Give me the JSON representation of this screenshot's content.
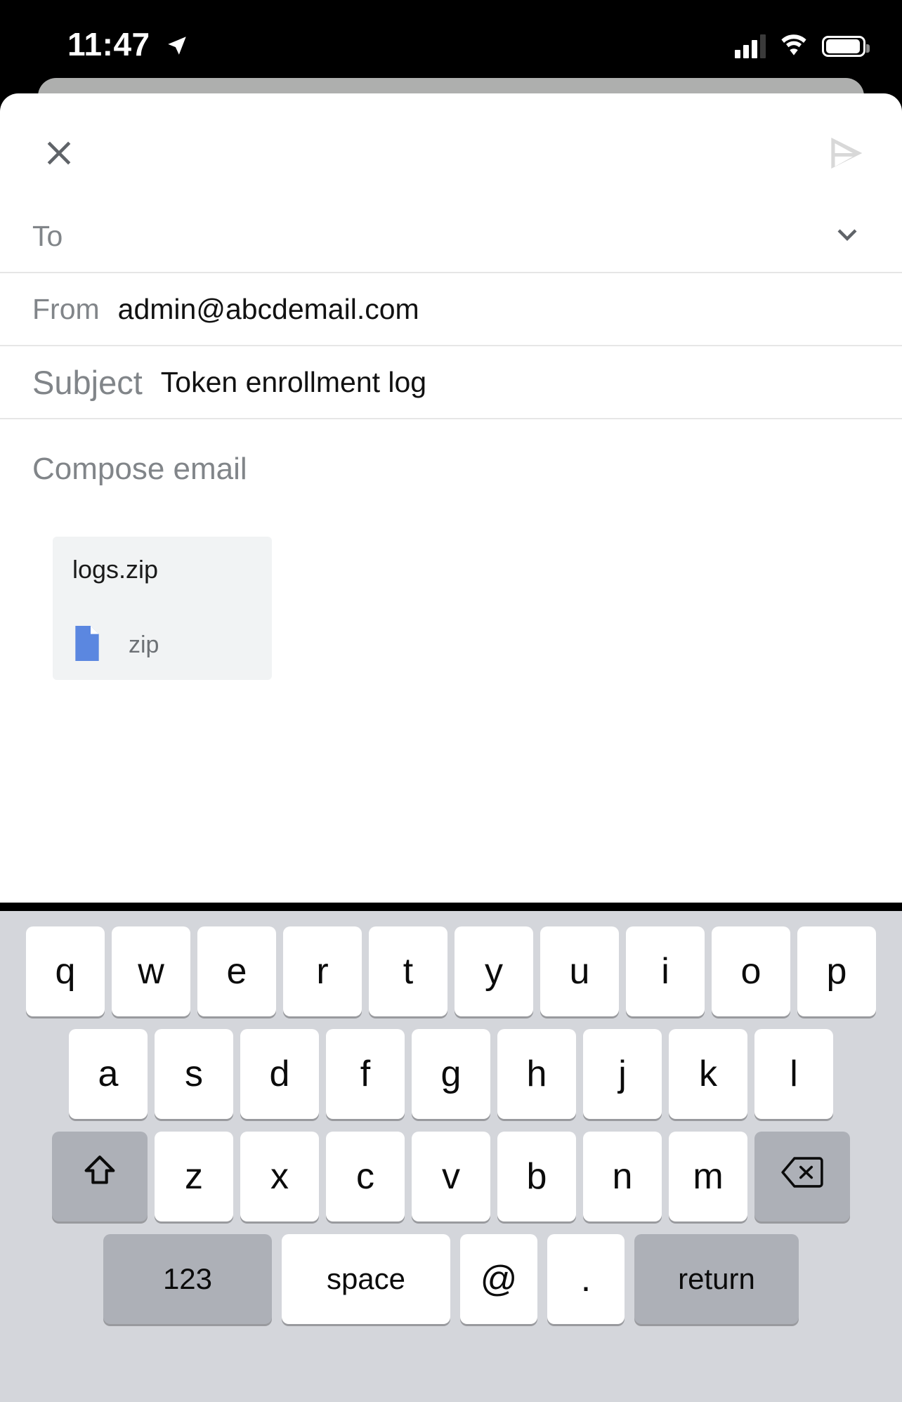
{
  "status_bar": {
    "time": "11:47",
    "location_icon": "location-arrow-icon",
    "signal_icon": "cellular-signal-icon",
    "wifi_icon": "wifi-icon",
    "battery_icon": "battery-icon"
  },
  "compose": {
    "close_icon": "close-icon",
    "send_icon": "send-icon",
    "to": {
      "placeholder": "To",
      "value": "",
      "expand_icon": "chevron-down-icon"
    },
    "from": {
      "label": "From",
      "value": "admin@abcdemail.com"
    },
    "subject": {
      "label": "Subject",
      "value": "Token enrollment log"
    },
    "body": {
      "placeholder": "Compose email",
      "value": ""
    },
    "attachment": {
      "filename": "logs.zip",
      "type_label": "zip",
      "file_icon": "file-icon",
      "icon_color": "#5b87e0"
    }
  },
  "keyboard": {
    "row1": [
      "q",
      "w",
      "e",
      "r",
      "t",
      "y",
      "u",
      "i",
      "o",
      "p"
    ],
    "row2": [
      "a",
      "s",
      "d",
      "f",
      "g",
      "h",
      "j",
      "k",
      "l"
    ],
    "row3": [
      "z",
      "x",
      "c",
      "v",
      "b",
      "n",
      "m"
    ],
    "shift_icon": "shift-icon",
    "backspace_icon": "backspace-icon",
    "numbers_key": "123",
    "space_key": "space",
    "at_key": "@",
    "period_key": ".",
    "return_key": "return"
  },
  "colors": {
    "keyboard_bg": "#d4d6db",
    "key_white": "#ffffff",
    "key_gray": "#adb0b7",
    "attachment_bg": "#f1f3f4",
    "placeholder_text": "#818589"
  }
}
